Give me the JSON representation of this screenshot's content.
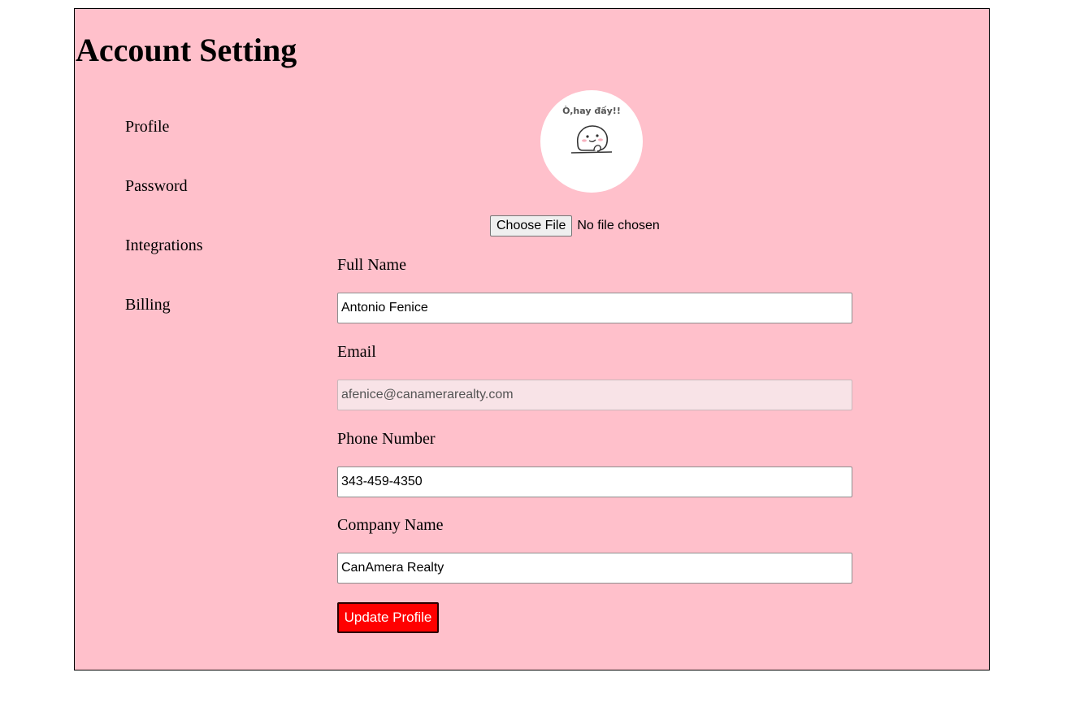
{
  "page": {
    "title": "Account Setting"
  },
  "sidebar": {
    "items": [
      {
        "label": "Profile"
      },
      {
        "label": "Password"
      },
      {
        "label": "Integrations"
      },
      {
        "label": "Billing"
      }
    ]
  },
  "avatar": {
    "caption": "Ò,hay đấy!!",
    "icon": "smiling-blob-sticker"
  },
  "file_upload": {
    "button_label": "Choose File",
    "status": "No file chosen"
  },
  "form": {
    "full_name": {
      "label": "Full Name",
      "value": "Antonio Fenice"
    },
    "email": {
      "label": "Email",
      "value": "afenice@canamerarealty.com",
      "disabled": true
    },
    "phone": {
      "label": "Phone Number",
      "value": "343-459-4350"
    },
    "company": {
      "label": "Company Name",
      "value": "CanAmera Realty"
    },
    "submit_label": "Update Profile"
  },
  "colors": {
    "panel_background": "#ffc0cb",
    "button_background": "#ff0000",
    "button_text": "#ffffff"
  }
}
